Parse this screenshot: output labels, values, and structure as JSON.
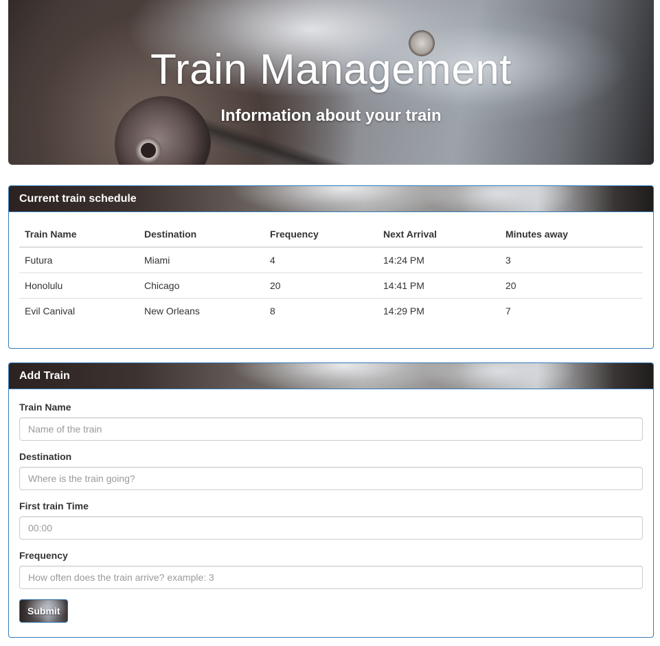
{
  "hero": {
    "title": "Train Management",
    "subtitle": "Information about your train"
  },
  "schedule": {
    "heading": "Current train schedule",
    "columns": [
      "Train Name",
      "Destination",
      "Frequency",
      "Next Arrival",
      "Minutes away"
    ],
    "rows": [
      [
        "Futura",
        "Miami",
        "4",
        "14:24 PM",
        "3"
      ],
      [
        "Honolulu",
        "Chicago",
        "20",
        "14:41 PM",
        "20"
      ],
      [
        "Evil Canival",
        "New Orleans",
        "8",
        "14:29 PM",
        "7"
      ]
    ]
  },
  "add_train": {
    "heading": "Add Train",
    "fields": [
      {
        "label": "Train Name",
        "placeholder": "Name of the train",
        "value": ""
      },
      {
        "label": "Destination",
        "placeholder": "Where is the train going?",
        "value": ""
      },
      {
        "label": "First train Time",
        "placeholder": "00:00",
        "value": ""
      },
      {
        "label": "Frequency",
        "placeholder": "How often does the train arrive? example: 3",
        "value": ""
      }
    ],
    "submit_label": "Submit"
  },
  "colors": {
    "panel_border": "#337ab7",
    "text": "#333333",
    "placeholder": "#999999"
  }
}
